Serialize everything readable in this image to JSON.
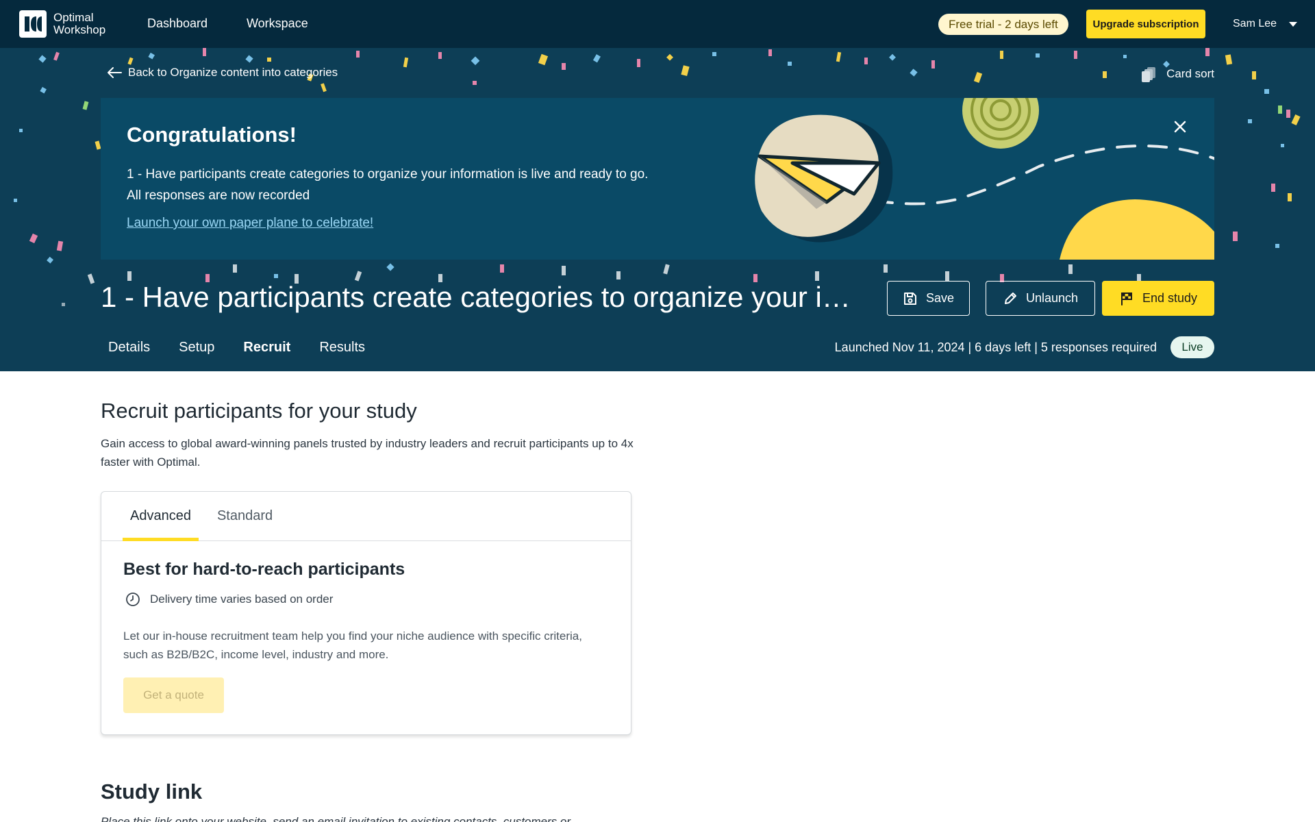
{
  "topnav": {
    "logo_line1": "Optimal",
    "logo_line2": "Workshop",
    "links": [
      "Dashboard",
      "Workspace"
    ],
    "trial_label": "Free trial - 2 days left",
    "upgrade_label": "Upgrade subscription",
    "user_name": "Sam Lee"
  },
  "hero": {
    "back_label": "Back to Organize content into categories",
    "study_type": "Card sort",
    "congrats": {
      "title": "Congratulations!",
      "line1": "1 - Have participants create categories to organize your information is live and ready to go.",
      "line2": "All responses are now recorded",
      "link": "Launch your own paper plane to celebrate!"
    },
    "study_title": "1 - Have participants create categories to organize your information",
    "buttons": {
      "save": "Save",
      "unlaunch": "Unlaunch",
      "end": "End study"
    },
    "tabs": [
      "Details",
      "Setup",
      "Recruit",
      "Results"
    ],
    "active_tab": "Recruit",
    "status_line": "Launched Nov 11, 2024 | 6 days left | 5 responses required",
    "status_badge": "Live"
  },
  "recruit": {
    "title": "Recruit participants for your study",
    "description": "Gain access to global award-winning panels trusted by industry leaders and recruit participants up to 4x faster with Optimal.",
    "card_tabs": [
      "Advanced",
      "Standard"
    ],
    "active_card_tab": "Advanced",
    "heading": "Best for hard-to-reach participants",
    "meta": "Delivery time varies based on order",
    "body": "Let our in-house recruitment team help you find your niche audience with specific criteria, such as B2B/B2C, income level, industry and more.",
    "button": "Get a quote"
  },
  "study_link": {
    "title": "Study link",
    "description": "Place this link onto your website, send an email invitation to existing contacts, customers or"
  },
  "colors": {
    "nav_bg": "#05293d",
    "hero_bg": "#0d3e56",
    "banner_bg": "#0a4a66",
    "accent_yellow": "#ffdc24",
    "live_badge_bg": "#e6f6ef"
  },
  "icons": {
    "logo": "optimal-logo-icon",
    "back": "arrow-left-icon",
    "study_type": "card-stack-icon",
    "close": "close-icon",
    "save": "floppy-disk-icon",
    "unlaunch": "pencil-icon",
    "end": "flag-icon",
    "clock": "clock-icon",
    "user_menu": "chevron-down-icon"
  }
}
